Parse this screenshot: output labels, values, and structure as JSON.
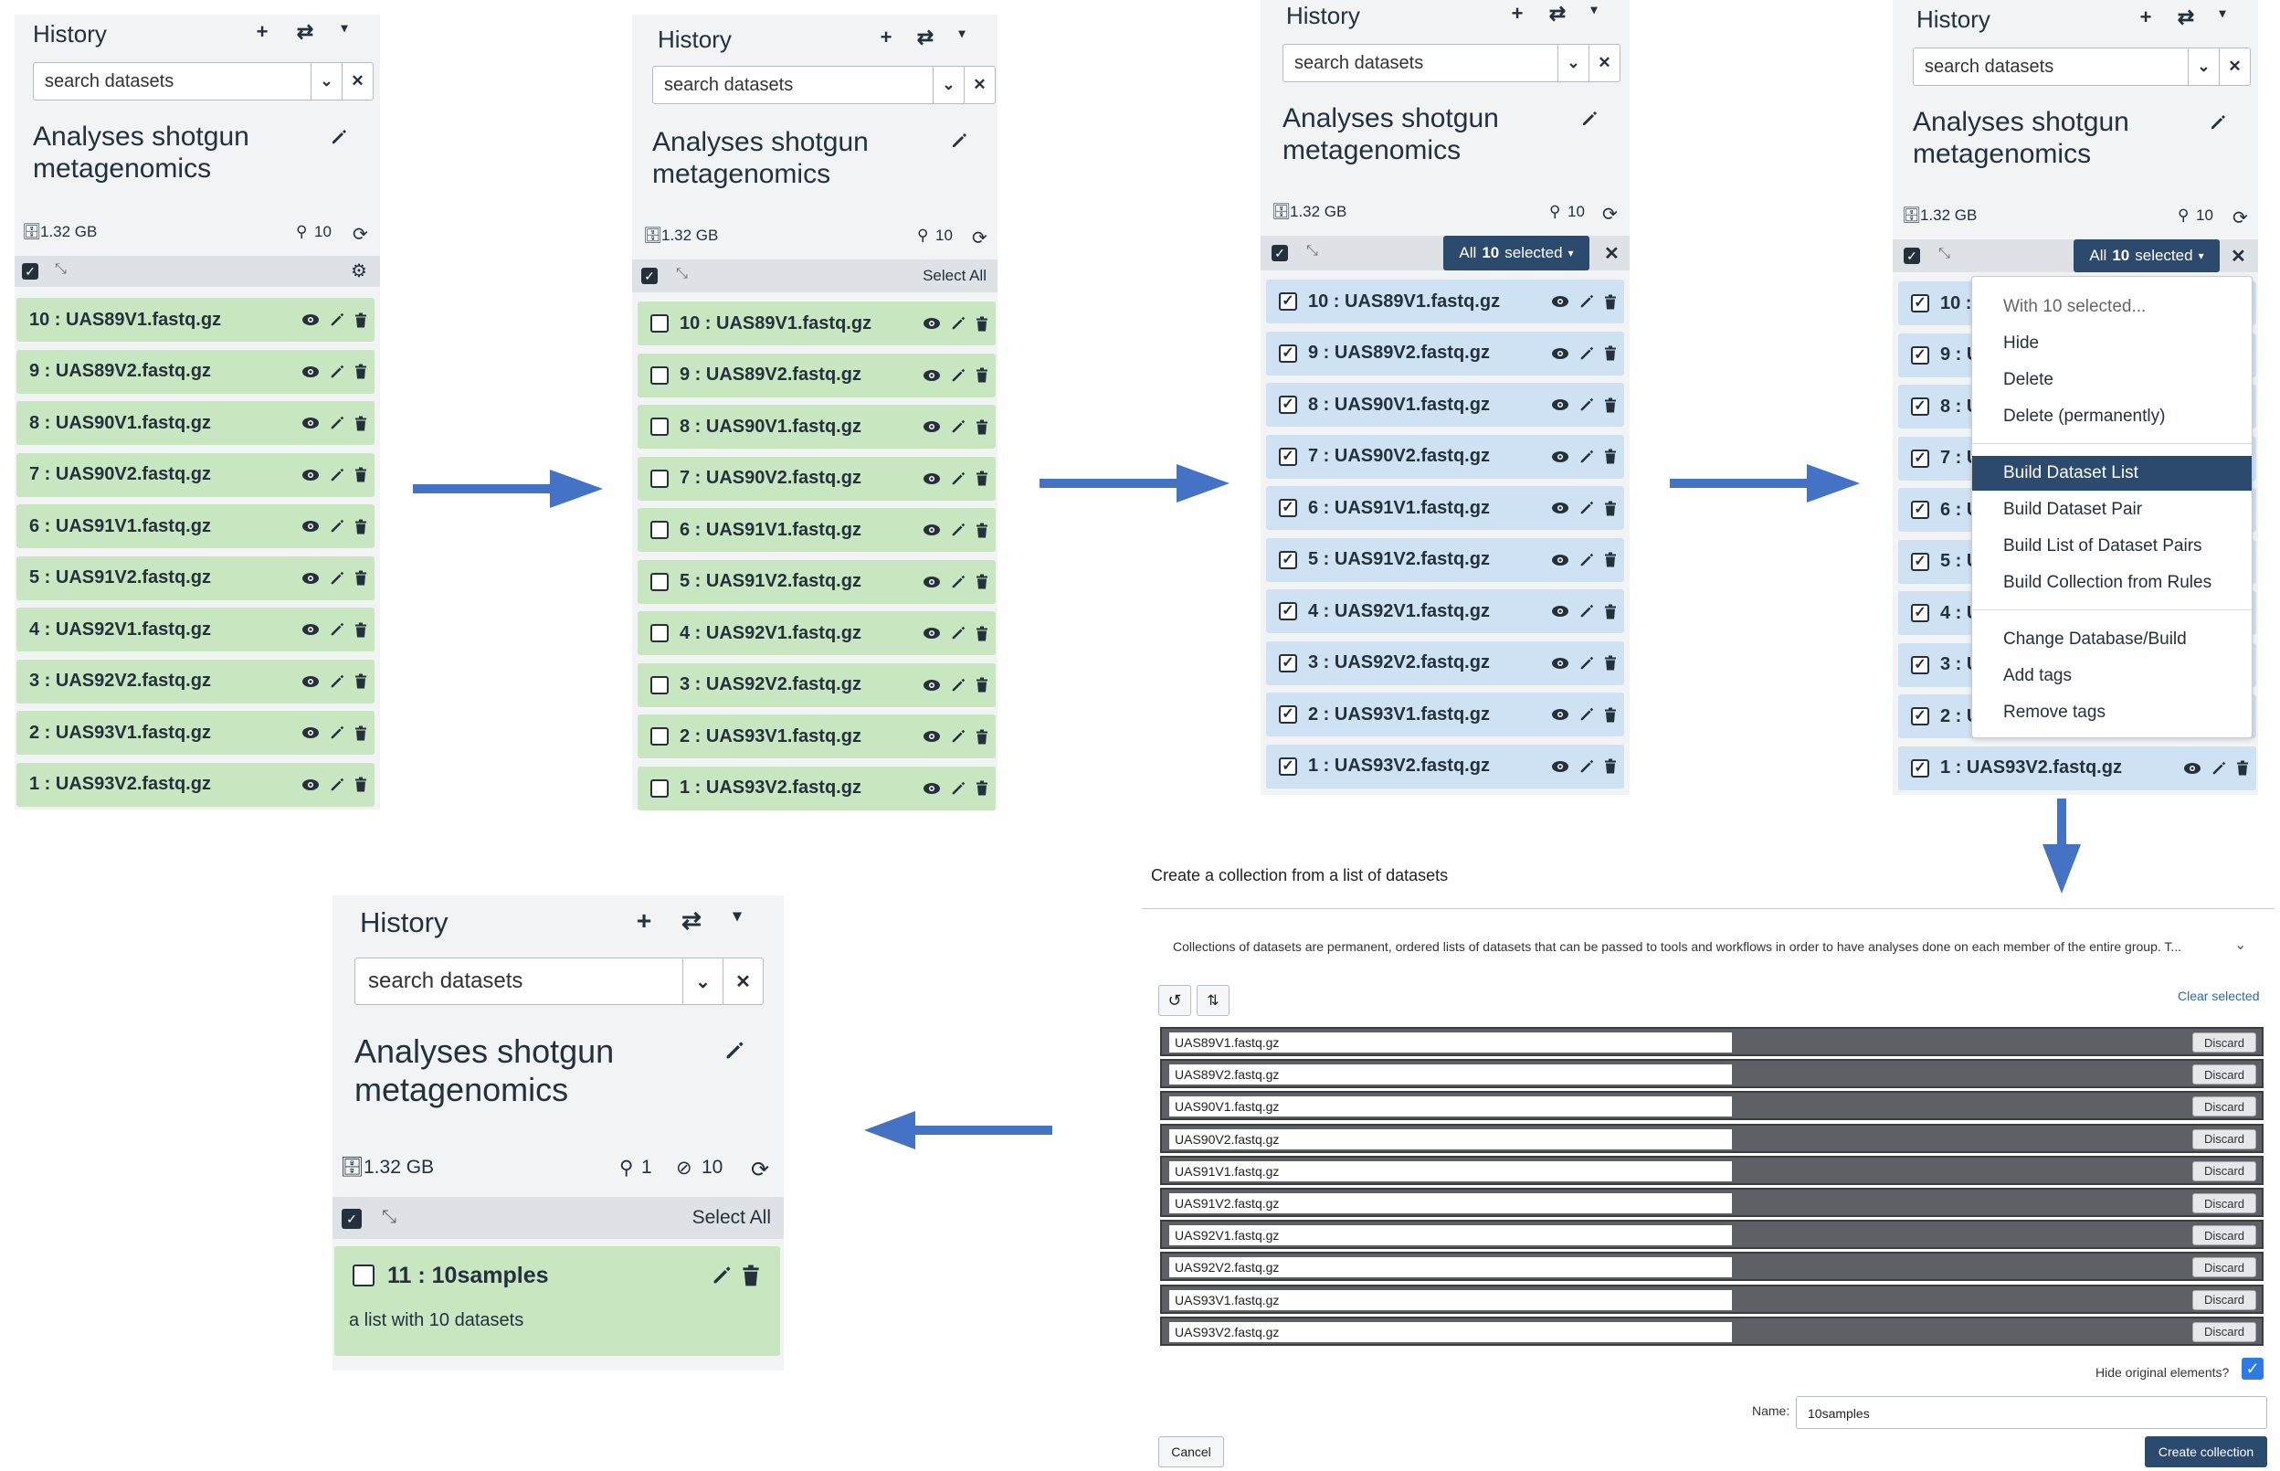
{
  "history": {
    "title": "History",
    "search_placeholder": "search datasets",
    "name": "Analyses shotgun metagenomics",
    "size": "1.32 GB",
    "shown_count": "10",
    "select_all": "Select All"
  },
  "datasets": [
    "10 : UAS89V1.fastq.gz",
    "9 : UAS89V2.fastq.gz",
    "8 : UAS90V1.fastq.gz",
    "7 : UAS90V2.fastq.gz",
    "6 : UAS91V1.fastq.gz",
    "5 : UAS91V2.fastq.gz",
    "4 : UAS92V1.fastq.gz",
    "3 : UAS92V2.fastq.gz",
    "2 : UAS93V1.fastq.gz",
    "1 : UAS93V2.fastq.gz"
  ],
  "selection": {
    "prefix": "All",
    "count": "10",
    "suffix": "selected"
  },
  "dropdown": {
    "header": "With 10 selected...",
    "group1": [
      "Hide",
      "Delete",
      "Delete (permanently)"
    ],
    "group2": [
      "Build Dataset List",
      "Build Dataset Pair",
      "Build List of Dataset Pairs",
      "Build Collection from Rules"
    ],
    "group3": [
      "Change Database/Build",
      "Add tags",
      "Remove tags"
    ],
    "highlighted": "Build Dataset List",
    "truncated_prefixes": [
      "10 :",
      "9 : U",
      "8 : U",
      "7 : U",
      "6 : U",
      "5 : U",
      "4 : U",
      "3 : U",
      "2 : U"
    ]
  },
  "collection_dialog": {
    "title": "Create a collection from a list of datasets",
    "description": "Collections of datasets are permanent, ordered lists of datasets that can be passed to tools and workflows in order to have analyses done on each member of the entire group. T...",
    "clear_selected": "Clear selected",
    "elements": [
      "UAS89V1.fastq.gz",
      "UAS89V2.fastq.gz",
      "UAS90V1.fastq.gz",
      "UAS90V2.fastq.gz",
      "UAS91V1.fastq.gz",
      "UAS91V2.fastq.gz",
      "UAS92V1.fastq.gz",
      "UAS92V2.fastq.gz",
      "UAS93V1.fastq.gz",
      "UAS93V2.fastq.gz"
    ],
    "discard_label": "Discard",
    "hide_original_label": "Hide original elements?",
    "hide_original_checked": true,
    "name_label": "Name:",
    "name_value": "10samples",
    "cancel_label": "Cancel",
    "create_label": "Create collection"
  },
  "final_history": {
    "shown_count": "1",
    "hidden_count": "10",
    "collection_title": "11 : 10samples",
    "collection_desc": "a list with 10 datasets"
  },
  "colors": {
    "dataset_ok": "#c8e6c0",
    "dataset_selected": "#cfe2f3",
    "primary": "#2c4a6e",
    "arrow": "#4472c4"
  }
}
